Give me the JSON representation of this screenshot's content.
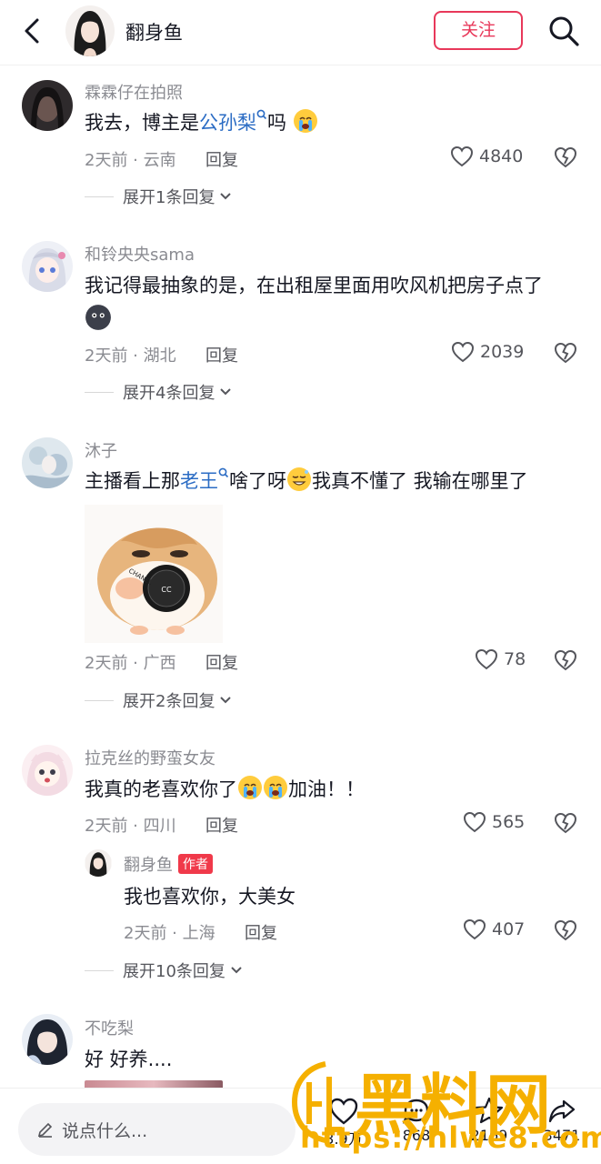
{
  "header": {
    "username": "翻身鱼",
    "follow_label": "关注"
  },
  "comments": [
    {
      "user": "霖霖仔在拍照",
      "text_before": "我去，博主是",
      "link": "公孙梨",
      "text_after": "吗",
      "time_loc": "2天前 · 云南",
      "reply_label": "回复",
      "likes": "4840",
      "expand": "展开1条回复"
    },
    {
      "user": "和铃央央sama",
      "text": "我记得最抽象的是，在出租屋里面用吹风机把房子点了",
      "time_loc": "2天前 · 湖北",
      "reply_label": "回复",
      "likes": "2039",
      "expand": "展开4条回复"
    },
    {
      "user": "沐子",
      "text_before": "主播看上那",
      "link": "老王",
      "text_mid": "啥了呀",
      "text_after": "我真不懂了 我输在哪里了",
      "image_text": "CHANEL",
      "time_loc": "2天前 · 广西",
      "reply_label": "回复",
      "likes": "78",
      "expand": "展开2条回复"
    },
    {
      "user": "拉克丝的野蛮女友",
      "text_before": "我真的老喜欢你了",
      "text_after": "加油！！",
      "time_loc": "2天前 · 四川",
      "reply_label": "回复",
      "likes": "565",
      "reply": {
        "user": "翻身鱼",
        "badge": "作者",
        "text": "我也喜欢你，大美女",
        "time_loc": "2天前 · 上海",
        "reply_label": "回复",
        "likes": "407"
      },
      "expand": "展开10条回复"
    },
    {
      "user": "不吃梨",
      "text": "好 好养...."
    }
  ],
  "bottom_bar": {
    "placeholder": "说点什么...",
    "likes": "3.9万",
    "comments": "868",
    "favorites": "2169",
    "shares": "3471"
  },
  "watermark": {
    "brand": "黑料网",
    "url": "https://hlwe8.com"
  },
  "colors": {
    "accent": "#e8385a",
    "link": "#2b6cc4",
    "watermark": "#f5b000"
  }
}
